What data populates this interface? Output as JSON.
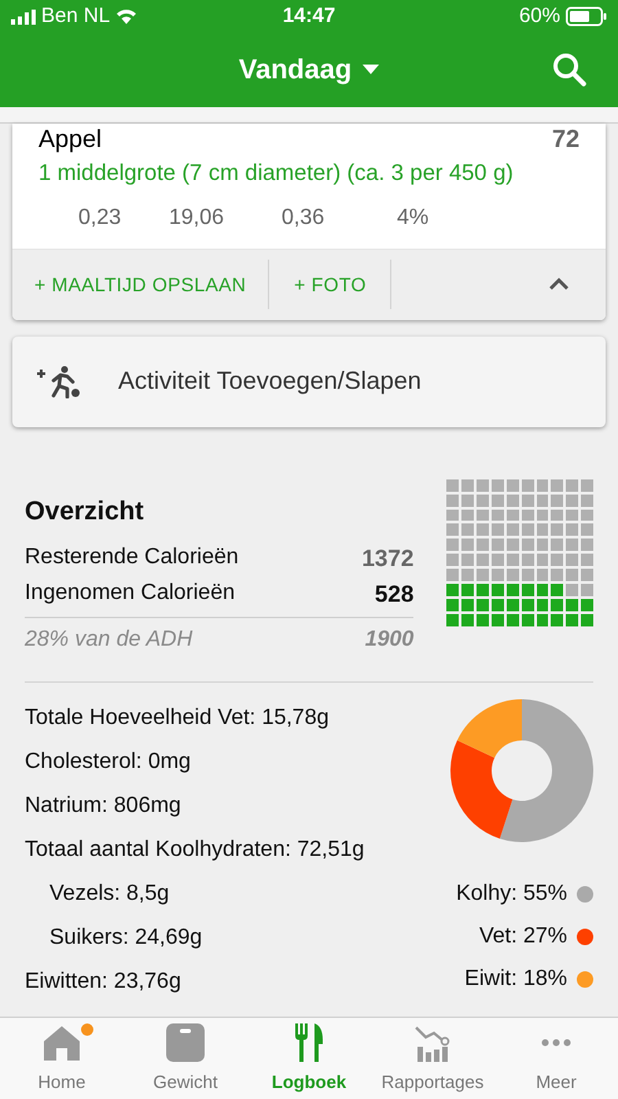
{
  "status_bar": {
    "carrier": "Ben NL",
    "time": "14:47",
    "battery": "60%"
  },
  "header": {
    "title": "Vandaag"
  },
  "food_entry": {
    "name": "Appel",
    "calories": "72",
    "serving": "1 middelgrote (7 cm diameter) (ca. 3 per 450 g)",
    "nutrients": [
      "0,23",
      "19,06",
      "0,36",
      "4%"
    ]
  },
  "entry_actions": [
    "+ MAALTIJD OPSLAAN",
    "+ FOTO"
  ],
  "activity_button": {
    "label": "Activiteit Toevoegen/Slapen"
  },
  "overview": {
    "title": "Overzicht",
    "rows": [
      {
        "label": "Resterende Calorieën",
        "value": "1372",
        "kind": "plain"
      },
      {
        "label": "Ingenomen Calorieën",
        "value": "528",
        "kind": "bold"
      }
    ],
    "footer_label": "28% van de ADH",
    "footer_value": "1900"
  },
  "nutrition": [
    {
      "label": "Totale Hoeveelheid Vet: 15,78g",
      "indented": false
    },
    {
      "label": "Cholesterol: 0mg",
      "indented": false
    },
    {
      "label": "Natrium: 806mg",
      "indented": false
    },
    {
      "label": "Totaal aantal Koolhydraten: 72,51g",
      "indented": false
    },
    {
      "label": "Vezels: 8,5g",
      "indented": true
    },
    {
      "label": "Suikers: 24,69g",
      "indented": true
    },
    {
      "label": "Eiwitten: 23,76g",
      "indented": false
    }
  ],
  "macros": {
    "chart_data": {
      "type": "donut",
      "values": [
        55,
        27,
        18
      ]
    },
    "legend": [
      {
        "label": "Kolhy: 55%",
        "color": "#aaaaaa"
      },
      {
        "label": "Vet: 27%",
        "color": "#fe4000"
      },
      {
        "label": "Eiwit: 18%",
        "color": "#fd9b24"
      }
    ]
  },
  "tabs": [
    {
      "label": "Home",
      "selected": false,
      "notification": true
    },
    {
      "label": "Gewicht",
      "selected": false,
      "notification": false
    },
    {
      "label": "Logboek",
      "selected": true,
      "notification": false
    },
    {
      "label": "Rapportages",
      "selected": false,
      "notification": false
    },
    {
      "label": "Meer",
      "selected": false,
      "notification": false
    }
  ]
}
